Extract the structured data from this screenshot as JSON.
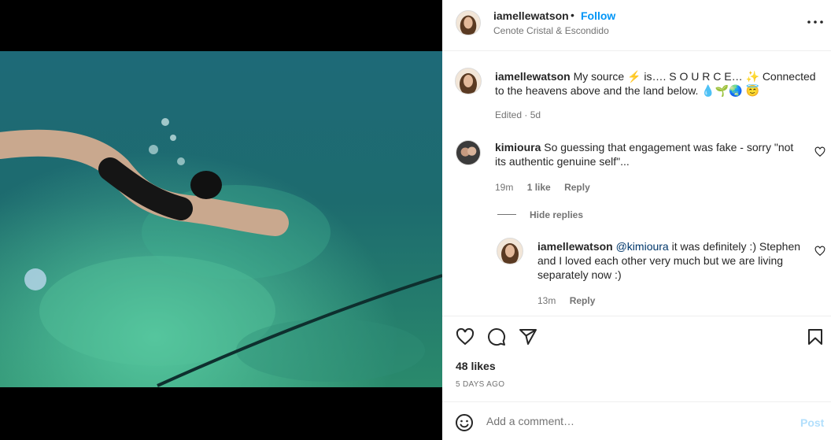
{
  "post": {
    "username": "iamellewatson",
    "follow_label": "Follow",
    "separator": "•",
    "location": "Cenote Cristal & Escondido"
  },
  "caption": {
    "username": "iamellewatson",
    "text": "My source ⚡ is…. S O U R C E… ✨ Connected to the heavens above and the land below. 💧🌱🌏 😇",
    "meta": "Edited · 5d"
  },
  "comments": [
    {
      "username": "kimioura",
      "text": "So guessing that engagement was fake - sorry \"not its authentic genuine self\"...",
      "time": "19m",
      "likes": "1 like",
      "reply_label": "Reply",
      "hide_replies": "Hide replies"
    }
  ],
  "replies": [
    {
      "username": "iamellewatson",
      "mention": "@kimioura",
      "text": "it was definitely :) Stephen and I loved each other very much but we are living separately now :)",
      "time": "13m",
      "reply_label": "Reply"
    }
  ],
  "likes_text": "48 likes",
  "date_text": "5 DAYS AGO",
  "add_comment_placeholder": "Add a comment…",
  "post_button": "Post",
  "colors": {
    "accent": "#0095f6",
    "post_disabled": "#b2dffc",
    "muted": "#737373"
  },
  "icons": [
    "more-options-icon",
    "heart-icon",
    "comment-icon",
    "share-icon",
    "bookmark-icon",
    "emoji-icon"
  ]
}
